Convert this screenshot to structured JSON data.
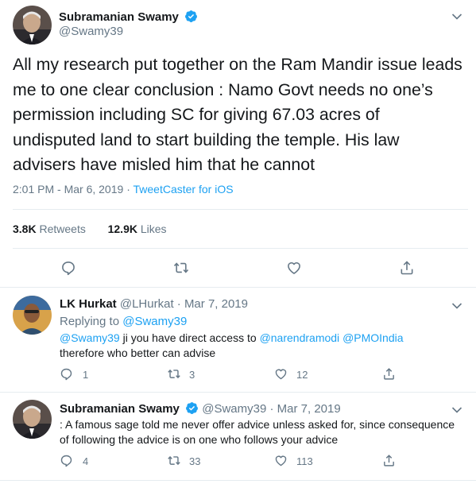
{
  "main_tweet": {
    "author_name": "Subramanian Swamy",
    "handle": "@Swamy39",
    "text": "All my research put together on the Ram Mandir issue leads me to one clear conclusion : Namo Govt needs no one’s permission including SC for giving 67.03 acres of undisputed land to start building the temple. His law advisers have misled him that he cannot",
    "time": "2:01 PM - Mar 6, 2019",
    "separator": "·",
    "source": "TweetCaster for iOS",
    "retweets_count": "3.8K",
    "retweets_label": "Retweets",
    "likes_count": "12.9K",
    "likes_label": "Likes"
  },
  "reply1": {
    "author_name": "LK Hurkat",
    "meta": "@LHurkat · Mar 7, 2019",
    "replying_label": "Replying to",
    "replying_handle": "@Swamy39",
    "mention1": "@Swamy39",
    "text1": " ji you have direct access to ",
    "mention2": "@narendramodi",
    "mention3": "@PMOIndia",
    "text2": "therefore who better can advise",
    "reply_count": "1",
    "retweet_count": "3",
    "like_count": "12"
  },
  "reply2": {
    "author_name": "Subramanian Swamy",
    "meta": "@Swamy39 · Mar 7, 2019",
    "text": ": A famous sage told me never offer advice unless asked for, since consequence of following the advice is on one who follows your advice",
    "reply_count": "4",
    "retweet_count": "33",
    "like_count": "113"
  },
  "colors": {
    "link": "#1da1f2",
    "secondary_text": "#657786",
    "verified_badge": "#1da1f2",
    "divider": "#e6ecf0"
  },
  "icons": [
    "verified-badge-icon",
    "chevron-down-icon",
    "reply-icon",
    "retweet-icon",
    "like-icon",
    "share-icon"
  ]
}
